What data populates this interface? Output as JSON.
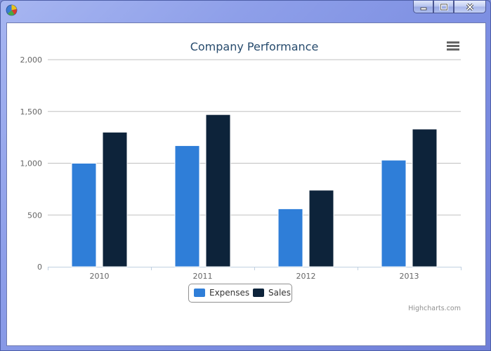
{
  "window": {
    "icon": "pie-chart-icon",
    "controls": [
      {
        "name": "minimize",
        "icon": "minimize-icon",
        "glyph": "▁"
      },
      {
        "name": "maximize",
        "icon": "maximize-icon",
        "glyph": "▣"
      },
      {
        "name": "close",
        "icon": "close-icon",
        "glyph": "✕"
      }
    ]
  },
  "chart_data": {
    "type": "bar",
    "title": "Company Performance",
    "xlabel": "",
    "ylabel": "",
    "categories": [
      "2010",
      "2011",
      "2012",
      "2013"
    ],
    "series": [
      {
        "name": "Expenses",
        "color": "#2f7ed8",
        "values": [
          1000,
          1170,
          560,
          1030
        ]
      },
      {
        "name": "Sales",
        "color": "#0d233a",
        "values": [
          1300,
          1470,
          740,
          1330
        ]
      }
    ],
    "ylim": [
      0,
      2000
    ],
    "yticks": [
      "0",
      "500",
      "1,000",
      "1,500",
      "2,000"
    ],
    "ytick_values": [
      0,
      500,
      1000,
      1500,
      2000
    ],
    "grid": true,
    "legend_position": "bottom-center"
  },
  "chart_menu": {
    "icon": "menu-icon"
  },
  "credits": "Highcharts.com"
}
